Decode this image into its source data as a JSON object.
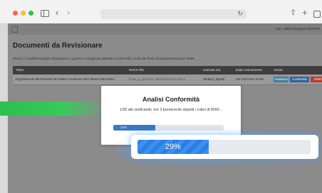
{
  "browser": {
    "icons": [
      "sidebar-icon",
      "back-chevron-icon",
      "forward-chevron-icon",
      "reload-icon",
      "share-icon",
      "plus-icon",
      "tabs-icon"
    ],
    "back_glyph": "‹",
    "forward_glyph": "›",
    "reload_glyph": "↻",
    "share_glyph": "⇪",
    "plus_glyph": "+"
  },
  "app": {
    "user_label": "Ciao, daffonsouperiore@PWSC",
    "page_title": "Documenti da Revisionare",
    "description": "Elenco i modelli template (Elegramm e genere consigli da Valutate Conformità e titoli dei flussi di programmazione finale.",
    "table": {
      "headers": [
        "Titolo",
        "Nome File",
        "Caricato Da",
        "Data Caricamento",
        "Azioni"
      ],
      "rows": [
        {
          "title": "Regolamento del Processo di Analisi e Gestione del Fattore informatico",
          "file": "flussi_e_gestione_fatt@informatico.docx",
          "uploaded_by": "Stefano_bigneli",
          "date": "AG-VOCOLO 10:48",
          "actions": [
            "Visualizza",
            "Conformità",
            "Elimina"
          ]
        }
      ]
    }
  },
  "modal": {
    "title": "Analisi Conformità",
    "text": "1/30 atti verificando che 3 Eemenente depetti i criteri di 8000...",
    "mini_progress": {
      "label": "22%",
      "value": 0.38
    }
  },
  "progress": {
    "label": "29%",
    "value": 0.29
  },
  "colors": {
    "accent_blue": "#2b7fe3",
    "green_strip": "#39c95a",
    "danger": "#c0392b"
  }
}
